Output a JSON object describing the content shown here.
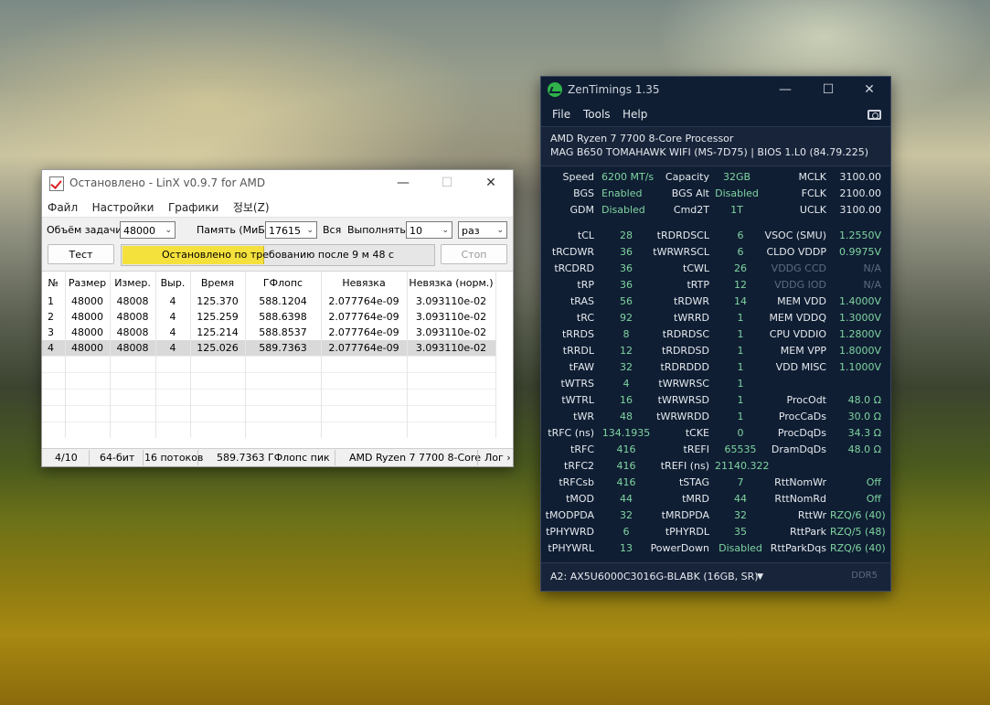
{
  "linx": {
    "title": "Остановлено - LinX v0.9.7 for AMD",
    "menu": [
      "Файл",
      "Настройки",
      "Графики",
      "정보(Z)"
    ],
    "problem_size_label": "Объём задачи:",
    "problem_size_value": "48000",
    "memory_label": "Память (МиБ):",
    "memory_value": "17615",
    "all_label": "Вся",
    "run_label": "Выполнять:",
    "run_value": "10",
    "run_unit": "раз",
    "test_button": "Тест",
    "progress_text": "Остановлено по требованию после 9 м 48 с",
    "progress_fraction": 0.45,
    "stop_button": "Стоп",
    "columns": [
      "№",
      "Размер",
      "Измер.",
      "Выр.",
      "Время",
      "ГФлопс",
      "Невязка",
      "Невязка (норм.)"
    ],
    "rows": [
      [
        "1",
        "48000",
        "48008",
        "4",
        "125.370",
        "588.1204",
        "2.077764e-09",
        "3.093110e-02"
      ],
      [
        "2",
        "48000",
        "48008",
        "4",
        "125.259",
        "588.6398",
        "2.077764e-09",
        "3.093110e-02"
      ],
      [
        "3",
        "48000",
        "48008",
        "4",
        "125.214",
        "588.8537",
        "2.077764e-09",
        "3.093110e-02"
      ],
      [
        "4",
        "48000",
        "48008",
        "4",
        "125.026",
        "589.7363",
        "2.077764e-09",
        "3.093110e-02"
      ]
    ],
    "status": {
      "progress": "4/10",
      "bits": "64-бит",
      "threads": "16 потоков",
      "peak": "589.7363 ГФлопс пик",
      "cpu": "AMD Ryzen 7 7700 8-Core",
      "log": "Лог ›"
    }
  },
  "zen": {
    "title": "ZenTimings 1.35",
    "menu": [
      "File",
      "Tools",
      "Help"
    ],
    "cpu": "AMD Ryzen 7 7700 8-Core Processor",
    "board": "MAG B650 TOMAHAWK WIFI (MS-7D75) | BIOS 1.L0 (84.79.225)",
    "top": [
      [
        "Speed",
        "6200 MT/s",
        "Capacity",
        "32GB",
        "MCLK",
        "3100.00"
      ],
      [
        "BGS",
        "Enabled",
        "BGS Alt",
        "Disabled",
        "FCLK",
        "2100.00"
      ],
      [
        "GDM",
        "Disabled",
        "Cmd2T",
        "1T",
        "UCLK",
        "3100.00"
      ]
    ],
    "timings": [
      [
        "tCL",
        "28",
        "tRDRDSCL",
        "6",
        "VSOC (SMU)",
        "1.2550V"
      ],
      [
        "tRCDWR",
        "36",
        "tWRWRSCL",
        "6",
        "CLDO VDDP",
        "0.9975V"
      ],
      [
        "tRCDRD",
        "36",
        "tCWL",
        "26",
        "VDDG CCD",
        "N/A"
      ],
      [
        "tRP",
        "36",
        "tRTP",
        "12",
        "VDDG IOD",
        "N/A"
      ],
      [
        "tRAS",
        "56",
        "tRDWR",
        "14",
        "MEM VDD",
        "1.4000V"
      ],
      [
        "tRC",
        "92",
        "tWRRD",
        "1",
        "MEM VDDQ",
        "1.3000V"
      ],
      [
        "tRRDS",
        "8",
        "tRDRDSC",
        "1",
        "CPU VDDIO",
        "1.2800V"
      ],
      [
        "tRRDL",
        "12",
        "tRDRDSD",
        "1",
        "MEM VPP",
        "1.8000V"
      ],
      [
        "tFAW",
        "32",
        "tRDRDDD",
        "1",
        "VDD MISC",
        "1.1000V"
      ],
      [
        "tWTRS",
        "4",
        "tWRWRSC",
        "1",
        "",
        ""
      ],
      [
        "tWTRL",
        "16",
        "tWRWRSD",
        "1",
        "ProcOdt",
        "48.0 Ω"
      ],
      [
        "tWR",
        "48",
        "tWRWRDD",
        "1",
        "ProcCaDs",
        "30.0 Ω"
      ],
      [
        "tRFC (ns)",
        "134.1935",
        "tCKE",
        "0",
        "ProcDqDs",
        "34.3 Ω"
      ],
      [
        "tRFC",
        "416",
        "tREFI",
        "65535",
        "DramDqDs",
        "48.0 Ω"
      ],
      [
        "tRFC2",
        "416",
        "tREFI (ns)",
        "21140.322",
        "",
        ""
      ],
      [
        "tRFCsb",
        "416",
        "tSTAG",
        "7",
        "RttNomWr",
        "Off"
      ],
      [
        "tMOD",
        "44",
        "tMRD",
        "44",
        "RttNomRd",
        "Off"
      ],
      [
        "tMODPDA",
        "32",
        "tMRDPDA",
        "32",
        "RttWr",
        "RZQ/6 (40)"
      ],
      [
        "tPHYWRD",
        "6",
        "tPHYRDL",
        "35",
        "RttPark",
        "RZQ/5 (48)"
      ],
      [
        "tPHYWRL",
        "13",
        "PowerDown",
        "Disabled",
        "RttParkDqs",
        "RZQ/6 (40)"
      ]
    ],
    "dimm": "A2: AX5U6000C3016G-BLABK (16GB, SR)",
    "ddr": "DDR5",
    "colors": {
      "value": "#7fd4a0",
      "dim": "#5d6b82",
      "bg": "#0f1e33"
    }
  }
}
